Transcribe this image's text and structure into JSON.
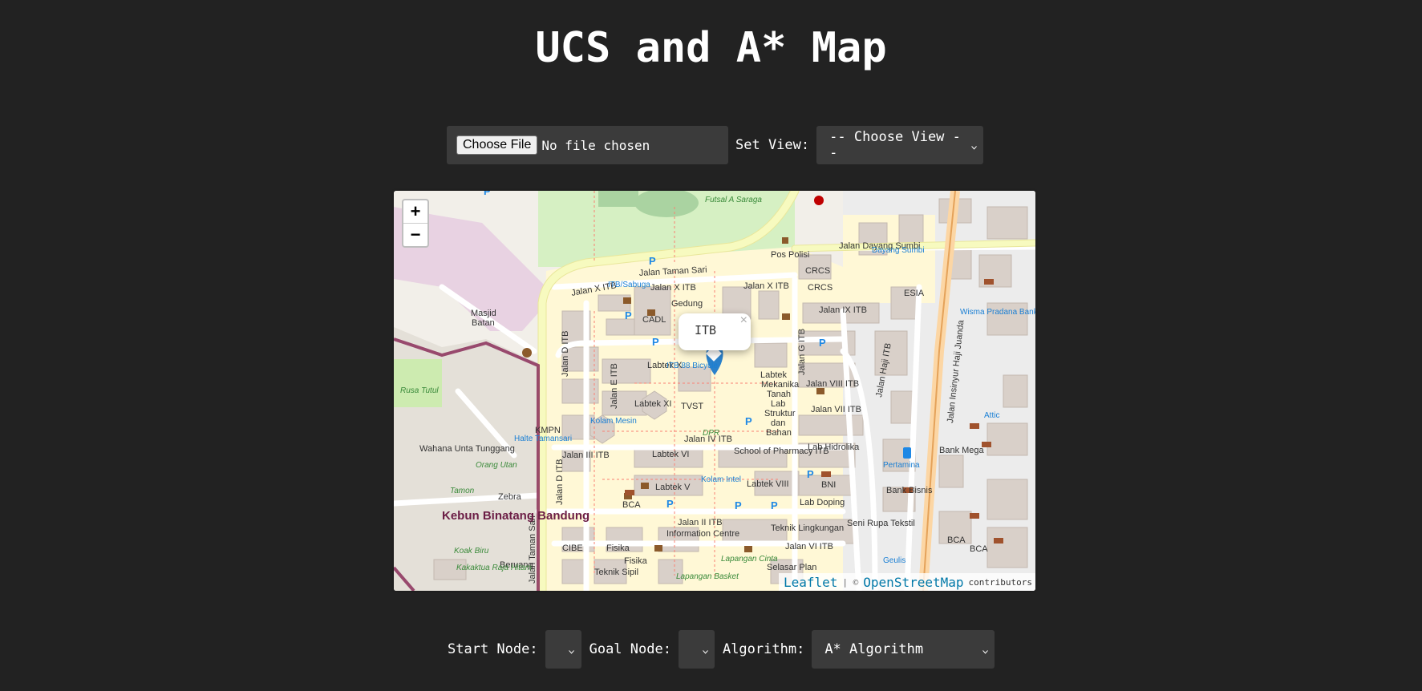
{
  "title": "UCS and A* Map",
  "top_controls": {
    "file_button": "Choose File",
    "file_status": "No file chosen",
    "set_view_label": "Set View:",
    "view_select": "-- Choose View --"
  },
  "map": {
    "popup_text": "ITB",
    "popup_close": "×",
    "zoom_in": "+",
    "zoom_out": "−",
    "attribution": {
      "leaflet": "Leaflet",
      "separator": "| ©",
      "osm": "OpenStreetMap",
      "contributors": "contributors"
    },
    "labels": {
      "jalan_taman_sari": "Jalan Taman Sari",
      "jalan_dayang_sumbi": "Jalan Dayang Sumbi",
      "jalan_x_itb": "Jalan X ITB",
      "jalan_ix_itb": "Jalan IX ITB",
      "jalan_viii_itb": "Jalan VIII ITB",
      "jalan_vii_itb": "Jalan VII ITB",
      "jalan_iv_itb": "Jalan IV ITB",
      "jalan_iii_itb": "Jalan III ITB",
      "jalan_ii_itb": "Jalan II ITB",
      "jalan_vi_itb": "Jalan VI ITB",
      "jalan_d_itb": "Jalan D ITB",
      "jalan_e_itb": "Jalan E ITB",
      "jalan_g_itb": "Jalan G ITB",
      "jalan_haji_itb": "Jalan Haji ITB",
      "jalan_insinyur": "Jalan Insinyur Haji Juanda",
      "itb_sabuga": "ITB/Sabuga",
      "pos_polisi": "Pos Polisi",
      "crcs1": "CRCS",
      "crcs2": "CRCS",
      "esia": "ESIA",
      "masjid": "Masjid",
      "batan": "Batan",
      "cadl": "CADL",
      "gedung": "Gedung",
      "labtek_x": "Labtek X",
      "labtek_xi": "Labtek XI",
      "labtek_vi": "Labtek VI",
      "labtek_v": "Labtek V",
      "labtek_viii": "Labtek VIII",
      "tvst": "TVST",
      "itb88": "ITB 88 Bicycle",
      "labtek": "Labtek",
      "mekanika": "Mekanika",
      "tanah": "Tanah",
      "lab": "Lab",
      "struktur": "Struktur",
      "dan": "dan",
      "bahan": "Bahan",
      "kolam_mesin": "Kolam Mesin",
      "kolam_intel": "Kolam Intel",
      "school_pharmacy": "School of Pharmacy ITB",
      "lab_hidrolika": "Lab Hidrolika",
      "lab_doping": "Lab Doping",
      "bni": "BNI",
      "bca1": "BCA",
      "bca2": "BCA",
      "bca3": "BCA",
      "bank_mega": "Bank Mega",
      "bank_bisnis": "Bank Bisnis",
      "pertamina": "Pertamina",
      "attic": "Attic",
      "wisma": "Wisma Pradana Bank BTN",
      "dayang_sumbi": "Dayang Sumbi",
      "kmpn": "KMPN",
      "halte": "Halte Tamansari",
      "wahana": "Wahana Unta Tunggang",
      "orang_utan": "Orang Utan",
      "zebra": "Zebra",
      "tamon": "Tamon",
      "kebun": "Kebun Binatang Bandung",
      "koak_biru": "Koak Biru",
      "kakaktua": "Kakaktua Raja Hitam",
      "beruang": "Beruang",
      "rusa_tutul": "Rusa Tutul",
      "cibe": "CIBE",
      "fisika1": "Fisika",
      "fisika2": "Fisika",
      "teknik_sipil": "Teknik Sipil",
      "info_centre": "Information Centre",
      "teknik_lingkungan": "Teknik Lingkungan",
      "seni_rupa": "Seni Rupa Tekstil",
      "lapangan_cinta": "Lapangan Cinta",
      "lapangan_basket": "Lapangan Basket",
      "selasar": "Selasar Plan",
      "geulis": "Geulis",
      "futsal": "Futsal A Saraga",
      "dpr": "DPR"
    }
  },
  "bottom_controls": {
    "start_label": "Start Node:",
    "start_value": "",
    "goal_label": "Goal Node:",
    "goal_value": "",
    "algorithm_label": "Algorithm:",
    "algorithm_value": "A* Algorithm"
  },
  "colors": {
    "background": "#222222",
    "control_bg": "#3b3b3b",
    "marker": "#2a81cb",
    "campus": "#fff8d6",
    "park": "#cdebb0",
    "zoo_boundary": "#8b2e5b"
  },
  "icons": [
    "chevron-down-icon",
    "map-marker-icon",
    "close-icon",
    "zoom-in-icon",
    "zoom-out-icon"
  ]
}
